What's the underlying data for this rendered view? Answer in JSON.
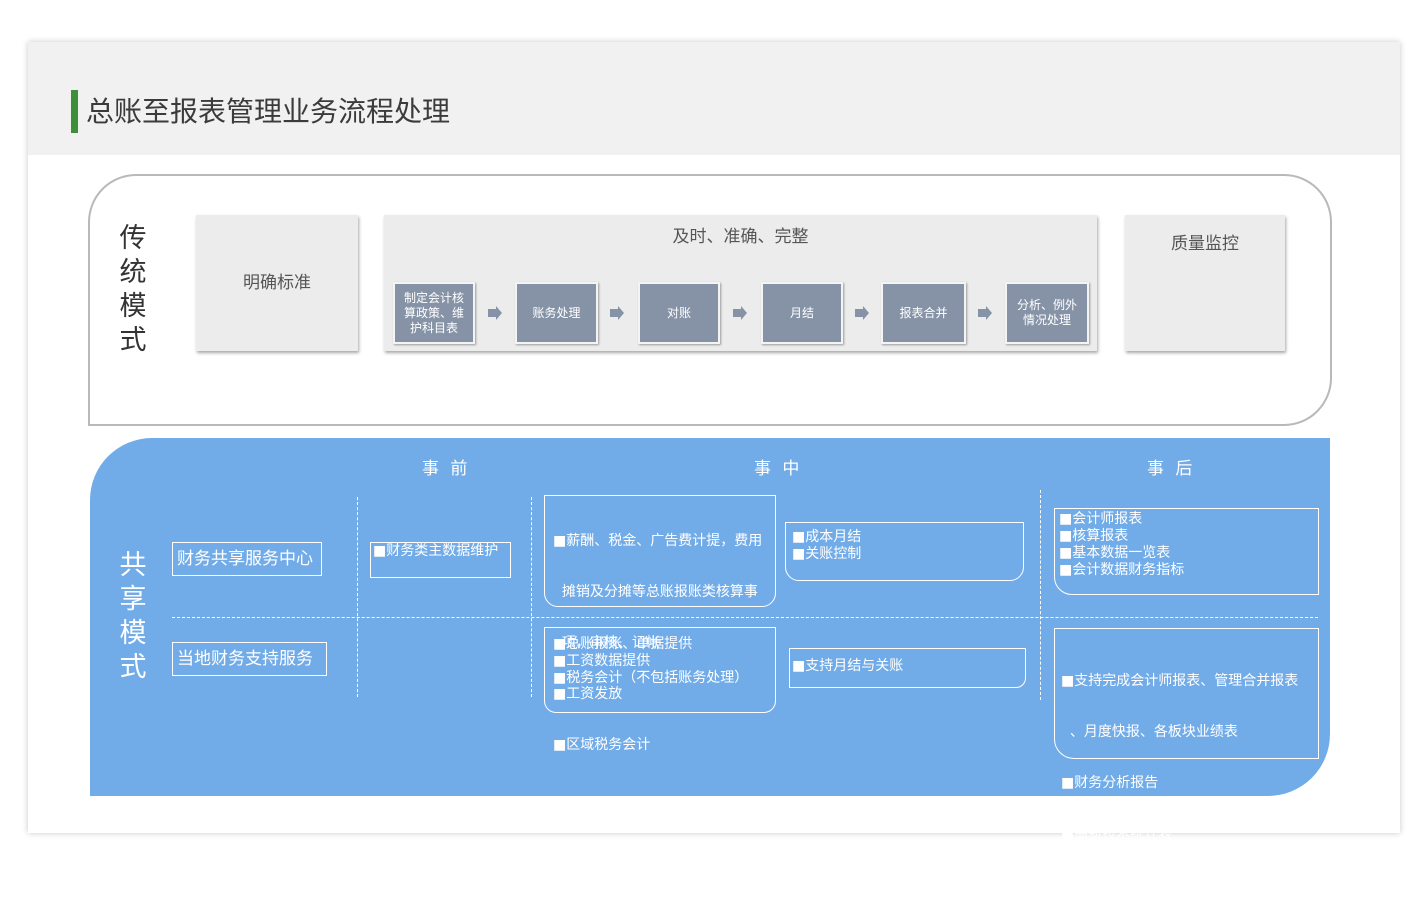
{
  "title": "总账至报表管理业务流程处理",
  "traditional": {
    "label": [
      "传",
      "统",
      "模",
      "式"
    ],
    "standard": "明确标准",
    "process_header": "及时、准确、完整",
    "steps": [
      "制定会计核\n算政策、维\n护科目表",
      "账务处理",
      "对账",
      "月结",
      "报表合并",
      "分析、例外\n情况处理"
    ],
    "quality": "质量监控"
  },
  "shared": {
    "label": [
      "共",
      "享",
      "模",
      "式"
    ],
    "phases": [
      "事 前",
      "事 中",
      "事 后"
    ],
    "rows": [
      {
        "service": "财务共享服务中心"
      },
      {
        "service": "当地财务支持服务"
      }
    ],
    "boxes": {
      "r1_pre": [
        "■财务类主数据维护"
      ],
      "r1_mid_a": [
        "■薪酬、税金、广告费计提，费用",
        "  摊销及分摊等总账报账类核算事",
        "  项，审核、记帐",
        "■工资发放",
        "■区域税务会计"
      ],
      "r1_mid_b": [
        "■成本月结",
        "■关账控制"
      ],
      "r1_post": [
        "■会计师报表",
        "■核算报表",
        "■基本数据一览表",
        "■会计数据财务指标"
      ],
      "r2_mid_a": [
        "■总账报账、单据提供",
        "■工资数据提供",
        "■税务会计（不包括账务处理）"
      ],
      "r2_mid_b": [
        "■支持月结与关账"
      ],
      "r2_post": [
        "■支持完成会计师报表、管理合并报表",
        "  、月度快报、各板块业绩表",
        "■财务分析报告",
        "■高新技术统计表",
        "■对外报表税务局、银行、统计局等"
      ]
    }
  },
  "colors": {
    "accent": "#3d8f3a",
    "shared_bg": "#72ace8",
    "step_bg": "#8693a7"
  }
}
